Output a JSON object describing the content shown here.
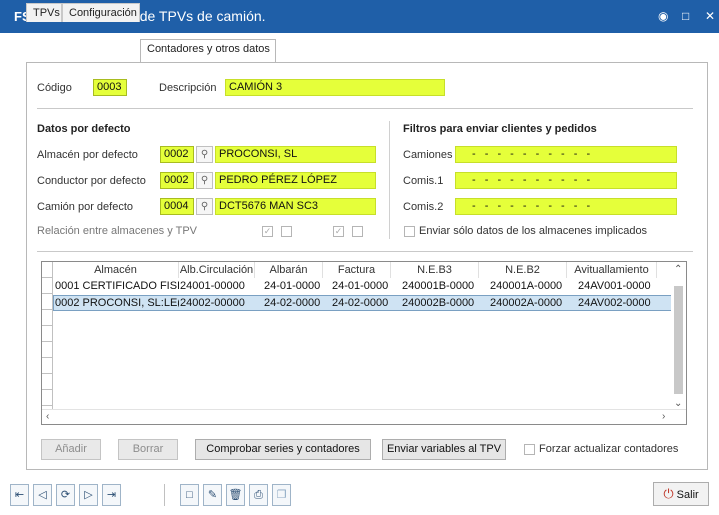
{
  "window": {
    "app_badge": "FS",
    "title": "Mantenimiento de TPVs de camión.",
    "buttons": [
      "pin-icon",
      "maximize-icon",
      "close-icon"
    ]
  },
  "tabs": [
    {
      "label": "TPVs",
      "active": false
    },
    {
      "label": "Configuración",
      "active": false
    },
    {
      "label": "Contadores y otros datos",
      "active": true
    }
  ],
  "header": {
    "codigo_label": "Código",
    "codigo_value": "0003",
    "descripcion_label": "Descripción",
    "descripcion_value": "CAMIÓN 3"
  },
  "defaults": {
    "title": "Datos por defecto",
    "almacen": {
      "label": "Almacén por defecto",
      "code": "0002",
      "name": "PROCONSI, SL"
    },
    "conductor": {
      "label": "Conductor por defecto",
      "code": "0002",
      "name": "PEDRO PÉREZ LÓPEZ"
    },
    "camion": {
      "label": "Camión por defecto",
      "code": "0004",
      "name": "DCT5676 MAN SC3"
    },
    "relacion_label": "Relación entre almacenes y TPV",
    "relacion_checks": [
      true,
      false,
      true,
      false
    ]
  },
  "filters": {
    "title": "Filtros para enviar clientes y pedidos",
    "camiones_label": "Camiones",
    "comis1_label": "Comis.1",
    "comis2_label": "Comis.2",
    "mask": "- - - - - - - - - -",
    "enviar_solo_label": "Enviar sólo datos de los almacenes implicados",
    "enviar_solo_checked": false
  },
  "grid": {
    "columns": [
      "Almacén",
      "Alb.Circulación",
      "Albarán",
      "Factura",
      "N.E.B3",
      "N.E.B2",
      "Avituallamiento"
    ],
    "rows": [
      {
        "almacen": "0001 CERTIFICADO FISI",
        "alb_circ": "24001-00000",
        "albaran": "24-01-0000",
        "factura": "24-01-0000",
        "neb3": "240001B-0000",
        "neb2": "240001A-0000",
        "avit": "24AV001-0000",
        "selected": false
      },
      {
        "almacen": "0002 PROCONSI, SL:LE(",
        "alb_circ": "24002-00000",
        "albaran": "24-02-0000",
        "factura": "24-02-0000",
        "neb3": "240002B-0000",
        "neb2": "240002A-0000",
        "avit": "24AV002-0000",
        "selected": true
      }
    ]
  },
  "actions": {
    "anadir": "Añadir",
    "borrar": "Borrar",
    "comprobar": "Comprobar series y contadores",
    "enviar_variables": "Enviar variables al TPV",
    "forzar_label": "Forzar actualizar contadores",
    "forzar_checked": false
  },
  "footer": {
    "nav_icons": [
      "first-record-icon",
      "previous-record-icon",
      "refresh-icon",
      "next-record-icon",
      "last-record-icon"
    ],
    "record_icons": [
      "new-record-icon",
      "edit-record-icon",
      "delete-record-icon",
      "print-icon",
      "copy-icon"
    ],
    "salir_label": "Salir"
  },
  "colors": {
    "titlebar": "#1f5fa8",
    "field_highlight": "#e5ff3a",
    "selected_row": "#cfe3f3"
  }
}
